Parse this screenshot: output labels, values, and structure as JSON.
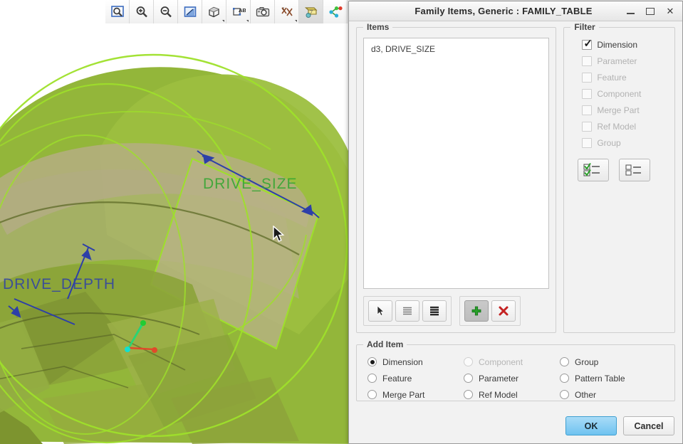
{
  "toolbar": {
    "buttons": [
      {
        "name": "zoom-fit-icon",
        "label": "Refit"
      },
      {
        "name": "zoom-in-icon",
        "label": "Zoom In"
      },
      {
        "name": "zoom-out-icon",
        "label": "Zoom Out"
      },
      {
        "name": "repaint-icon",
        "label": "Repaint"
      },
      {
        "name": "display-style-icon",
        "label": "Display Style"
      },
      {
        "name": "annotation-display-icon",
        "label": "Annotation Display"
      },
      {
        "name": "saved-view-icon",
        "label": "Saved View"
      },
      {
        "name": "datum-display-icon",
        "label": "Datum Display Filters"
      },
      {
        "name": "plane-display-icon",
        "label": "Plane Display"
      },
      {
        "name": "axis-display-icon",
        "label": "Axis Display"
      }
    ]
  },
  "dialog": {
    "title": "Family Items,  Generic : FAMILY_TABLE",
    "window_controls": {
      "minimize": "minimize-button",
      "maximize": "maximize-button",
      "close": "close-button"
    },
    "items": {
      "group_label": "Items",
      "list": [
        "d3, DRIVE_SIZE"
      ],
      "tools": [
        {
          "name": "select-pointer-button",
          "label": "Select"
        },
        {
          "name": "list-compact-button",
          "label": "List"
        },
        {
          "name": "list-detail-button",
          "label": "Details"
        }
      ],
      "actions": [
        {
          "name": "add-item-button",
          "label": "Add",
          "pressed": true
        },
        {
          "name": "delete-item-button",
          "label": "Delete",
          "pressed": false
        }
      ]
    },
    "filter": {
      "group_label": "Filter",
      "options": [
        {
          "label": "Dimension",
          "checked": true,
          "enabled": true
        },
        {
          "label": "Parameter",
          "checked": false,
          "enabled": false
        },
        {
          "label": "Feature",
          "checked": false,
          "enabled": false
        },
        {
          "label": "Component",
          "checked": false,
          "enabled": false
        },
        {
          "label": "Merge Part",
          "checked": false,
          "enabled": false
        },
        {
          "label": "Ref Model",
          "checked": false,
          "enabled": false
        },
        {
          "label": "Group",
          "checked": false,
          "enabled": false
        }
      ],
      "buttons": [
        {
          "name": "select-all-filters-button",
          "label": "Select All"
        },
        {
          "name": "clear-all-filters-button",
          "label": "Clear All"
        }
      ]
    },
    "add_item": {
      "group_label": "Add Item",
      "options": [
        {
          "label": "Dimension",
          "selected": true,
          "enabled": true
        },
        {
          "label": "Feature",
          "selected": false,
          "enabled": true
        },
        {
          "label": "Merge Part",
          "selected": false,
          "enabled": true
        },
        {
          "label": "Component",
          "selected": false,
          "enabled": false
        },
        {
          "label": "Parameter",
          "selected": false,
          "enabled": true
        },
        {
          "label": "Ref Model",
          "selected": false,
          "enabled": true
        },
        {
          "label": "Group",
          "selected": false,
          "enabled": true
        },
        {
          "label": "Pattern Table",
          "selected": false,
          "enabled": true
        },
        {
          "label": "Other",
          "selected": false,
          "enabled": true
        }
      ]
    },
    "footer": {
      "ok_label": "OK",
      "cancel_label": "Cancel"
    }
  },
  "viewport": {
    "dimension_labels": [
      {
        "name": "dimension-label-drive-size",
        "text": "DRIVE_SIZE",
        "color": "#2fa62f"
      },
      {
        "name": "dimension-label-drive-depth",
        "text": "DRIVE_DEPTH",
        "color": "#2d3fa8"
      }
    ],
    "colors": {
      "model_green": "#93b63a",
      "model_green_dark": "#7c9432",
      "model_khaki": "#b5ae82",
      "edge_highlight": "#9ee02a",
      "dimension_blue": "#2d3fa8",
      "selected_green": "#2fa62f"
    }
  }
}
